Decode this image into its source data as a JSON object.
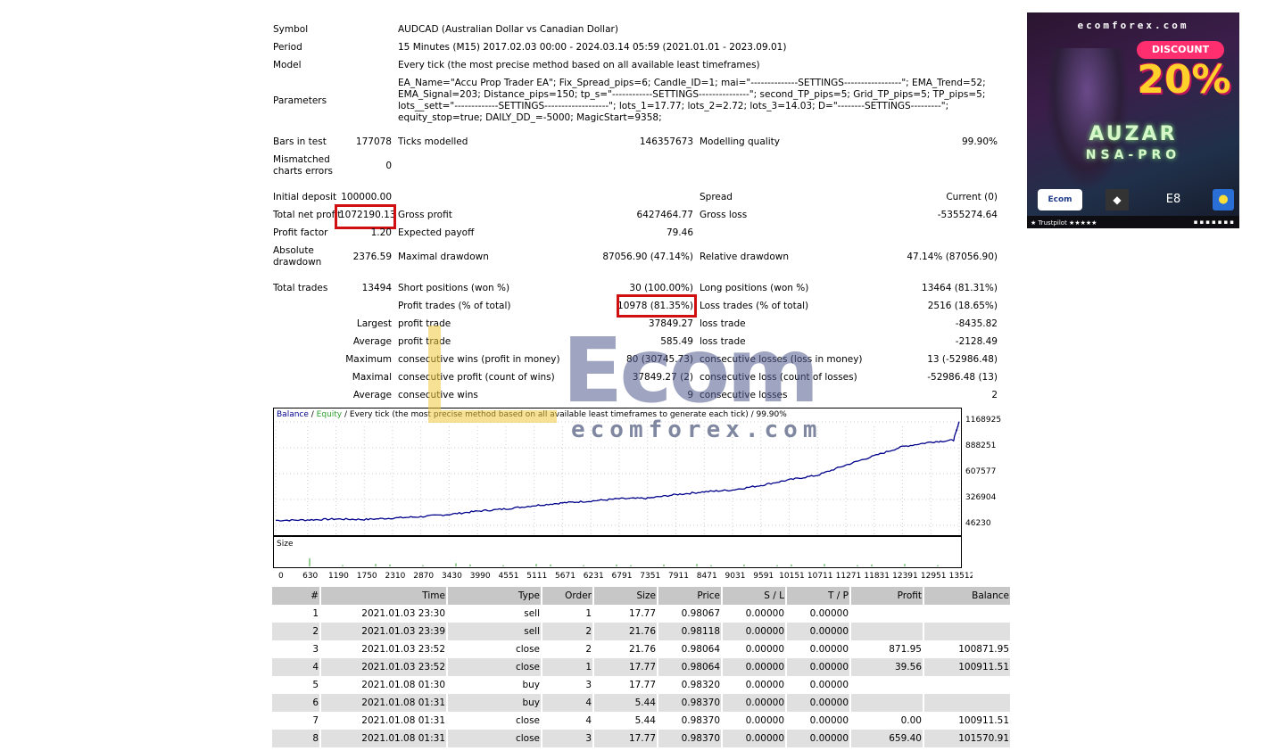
{
  "summary": {
    "symbol_label": "Symbol",
    "symbol_value": "AUDCAD (Australian Dollar vs Canadian Dollar)",
    "period_label": "Period",
    "period_value": "15 Minutes (M15) 2017.02.03 00:00 - 2024.03.14 05:59 (2021.01.01 - 2023.09.01)",
    "model_label": "Model",
    "model_value": "Every tick (the most precise method based on all available least timeframes)",
    "parameters_label": "Parameters",
    "parameters_lines": [
      "EA_Name=\"Accu Prop Trader EA\"; Fix_Spread_pips=6; Candle_ID=1; mai=\"--------------SETTINGS-----------------\"; EMA_Trend=52;",
      "EMA_Signal=203; Distance_pips=150; tp_s=\"------------SETTINGS---------------\"; second_TP_pips=5; Grid_TP_pips=5; TP_pips=5;",
      "lots__sett=\"-------------SETTINGS-------------------\"; lots_1=17.77; lots_2=2.72; lots_3=14.03; D=\"--------SETTINGS---------\";",
      "equity_stop=true; DAILY_DD_=-5000; MagicStart=9358;"
    ]
  },
  "stats": {
    "bars_label": "Bars in test",
    "bars_value": "177078",
    "ticks_label": "Ticks modelled",
    "ticks_value": "146357673",
    "quality_label": "Modelling quality",
    "quality_value": "99.90%",
    "mismatch_label_1": "Mismatched",
    "mismatch_label_2": "charts errors",
    "mismatch_value": "0",
    "initial_label": "Initial deposit",
    "initial_value": "100000.00",
    "spread_label": "Spread",
    "spread_value": "Current (0)",
    "net_label": "Total net profit",
    "net_value": "1072190.13",
    "gross_profit_label": "Gross profit",
    "gross_profit_value": "6427464.77",
    "gross_loss_label": "Gross loss",
    "gross_loss_value": "-5355274.64",
    "pf_label": "Profit factor",
    "pf_value": "1.20",
    "payoff_label": "Expected payoff",
    "payoff_value": "79.46",
    "absdd_label_1": "Absolute",
    "absdd_label_2": "drawdown",
    "absdd_value": "2376.59",
    "maxdd_label": "Maximal drawdown",
    "maxdd_value": "87056.90 (47.14%)",
    "reldd_label": "Relative drawdown",
    "reldd_value": "47.14% (87056.90)",
    "total_trades_label": "Total trades",
    "total_trades_value": "13494",
    "short_label": "Short positions (won %)",
    "short_value": "30 (100.00%)",
    "long_label": "Long positions (won %)",
    "long_value": "13464 (81.31%)",
    "profit_trades_label": "Profit trades (% of total)",
    "profit_trades_value": "10978 (81.35%)",
    "loss_trades_label": "Loss trades (% of total)",
    "loss_trades_value": "2516 (18.65%)",
    "rows": [
      {
        "pre": "Largest",
        "a_label": "profit trade",
        "a_value": "37849.27",
        "b_label": "loss trade",
        "b_value": "-8435.82"
      },
      {
        "pre": "Average",
        "a_label": "profit trade",
        "a_value": "585.49",
        "b_label": "loss trade",
        "b_value": "-2128.49"
      },
      {
        "pre": "Maximum",
        "a_label": "consecutive wins (profit in money)",
        "a_value": "80 (30745.73)",
        "b_label": "consecutive losses (loss in money)",
        "b_value": "13 (-52986.48)"
      },
      {
        "pre": "Maximal",
        "a_label": "consecutive profit (count of wins)",
        "a_value": "37849.27 (2)",
        "b_label": "consecutive loss (count of losses)",
        "b_value": "-52986.48 (13)"
      },
      {
        "pre": "Average",
        "a_label": "consecutive wins",
        "a_value": "9",
        "b_label": "consecutive losses",
        "b_value": "2"
      }
    ]
  },
  "chart_header": {
    "balance": "Balance",
    "sep": " / ",
    "equity": "Equity",
    "rest": " / Every tick (the most precise method based on all available least timeframes to generate each tick) / 99.90%"
  },
  "size_label": "Size",
  "chart_data": {
    "type": "line",
    "series": [
      {
        "name": "Balance",
        "color": "#00008b"
      }
    ],
    "y_ticks": [
      "1168925",
      "888251",
      "607577",
      "326904",
      "46230"
    ],
    "ylim": [
      46230,
      1168925
    ],
    "x_ticks": [
      "0",
      "630",
      "1190",
      "1750",
      "2310",
      "2870",
      "3430",
      "3990",
      "4551",
      "5111",
      "5671",
      "6231",
      "6791",
      "7351",
      "7911",
      "8471",
      "9031",
      "9591",
      "10151",
      "10711",
      "11271",
      "11831",
      "12391",
      "12951",
      "13512"
    ],
    "xlim": [
      0,
      13512
    ],
    "balance_points": [
      [
        0,
        100000
      ],
      [
        630,
        105000
      ],
      [
        1190,
        115000
      ],
      [
        1750,
        110000
      ],
      [
        2310,
        125000
      ],
      [
        2870,
        140000
      ],
      [
        3430,
        165000
      ],
      [
        3990,
        200000
      ],
      [
        4551,
        225000
      ],
      [
        5111,
        260000
      ],
      [
        5671,
        290000
      ],
      [
        6231,
        310000
      ],
      [
        6791,
        335000
      ],
      [
        7351,
        340000
      ],
      [
        7911,
        380000
      ],
      [
        8471,
        410000
      ],
      [
        9031,
        430000
      ],
      [
        9591,
        480000
      ],
      [
        10151,
        540000
      ],
      [
        10711,
        590000
      ],
      [
        11271,
        700000
      ],
      [
        11831,
        800000
      ],
      [
        12391,
        900000
      ],
      [
        12951,
        950000
      ],
      [
        13400,
        970000
      ],
      [
        13512,
        1172000
      ]
    ],
    "size_spikes": [
      13,
      2,
      4,
      3,
      2,
      5,
      3,
      2,
      4,
      3,
      2,
      3,
      2,
      3,
      4,
      2,
      3,
      2,
      3,
      4,
      2,
      3,
      4,
      2
    ]
  },
  "trades": {
    "headers": [
      "#",
      "Time",
      "Type",
      "Order",
      "Size",
      "Price",
      "S / L",
      "T / P",
      "Profit",
      "Balance"
    ],
    "rows": [
      [
        "1",
        "2021.01.03 23:30",
        "sell",
        "1",
        "17.77",
        "0.98067",
        "0.00000",
        "0.00000",
        "",
        ""
      ],
      [
        "2",
        "2021.01.03 23:39",
        "sell",
        "2",
        "21.76",
        "0.98118",
        "0.00000",
        "0.00000",
        "",
        ""
      ],
      [
        "3",
        "2021.01.03 23:52",
        "close",
        "2",
        "21.76",
        "0.98064",
        "0.00000",
        "0.00000",
        "871.95",
        "100871.95"
      ],
      [
        "4",
        "2021.01.03 23:52",
        "close",
        "1",
        "17.77",
        "0.98064",
        "0.00000",
        "0.00000",
        "39.56",
        "100911.51"
      ],
      [
        "5",
        "2021.01.08 01:30",
        "buy",
        "3",
        "17.77",
        "0.98320",
        "0.00000",
        "0.00000",
        "",
        ""
      ],
      [
        "6",
        "2021.01.08 01:31",
        "buy",
        "4",
        "5.44",
        "0.98370",
        "0.00000",
        "0.00000",
        "",
        ""
      ],
      [
        "7",
        "2021.01.08 01:31",
        "close",
        "4",
        "5.44",
        "0.98370",
        "0.00000",
        "0.00000",
        "0.00",
        "100911.51"
      ],
      [
        "8",
        "2021.01.08 01:31",
        "close",
        "3",
        "17.77",
        "0.98370",
        "0.00000",
        "0.00000",
        "659.40",
        "101570.91"
      ]
    ]
  },
  "ad": {
    "brand": "ecomforex.com",
    "discount": "DISCOUNT",
    "percent": "20%",
    "title1": "AUZAR",
    "title2": "NSA-PRO",
    "ecom_logo": "Ecom",
    "e8_logo": "E8",
    "trustpilot": "★ Trustpilot ★★★★★"
  },
  "watermark": {
    "eco": "Ecom",
    "site": "ecomforex.com"
  }
}
